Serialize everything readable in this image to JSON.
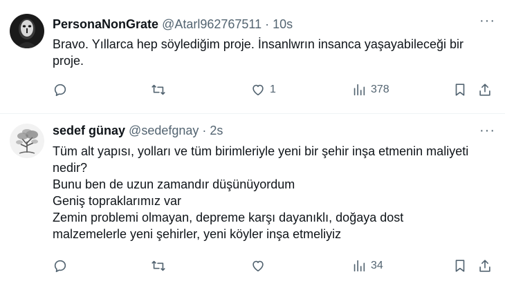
{
  "tweets": [
    {
      "name": "PersonaNonGrate",
      "handle": "@Atarl962767511",
      "separator": "·",
      "time": "10s",
      "text_lines": [
        "Bravo. Yıllarca hep söylediğim proje. İnsanlwrın insanca yaşayabileceği bir",
        "proje."
      ],
      "actions": {
        "replies": "",
        "retweets": "",
        "likes": "1",
        "views": "378"
      },
      "more": "···",
      "avatar": "masked-figure"
    },
    {
      "name": "sedef günay",
      "handle": "@sedefgnay",
      "separator": "·",
      "time": "2s",
      "text_lines": [
        "Tüm alt yapısı, yolları ve tüm birimleriyle yeni bir şehir inşa etmenin maliyeti",
        "nedir?",
        "Bunu ben de uzun zamandır düşünüyordum",
        "Geniş topraklarımız var",
        "Zemin problemi olmayan, depreme karşı dayanıklı, doğaya dost",
        "malzemelerle yeni şehirler, yeni köyler inşa etmeliyiz"
      ],
      "actions": {
        "replies": "",
        "retweets": "",
        "likes": "",
        "views": "34"
      },
      "more": "···",
      "avatar": "tree-sketch"
    }
  ],
  "colors": {
    "text": "#0f1419",
    "muted": "#536471",
    "divider": "#eff3f4"
  },
  "icons": [
    "reply-icon",
    "retweet-icon",
    "like-icon",
    "views-icon",
    "bookmark-icon",
    "share-icon",
    "more-icon"
  ]
}
